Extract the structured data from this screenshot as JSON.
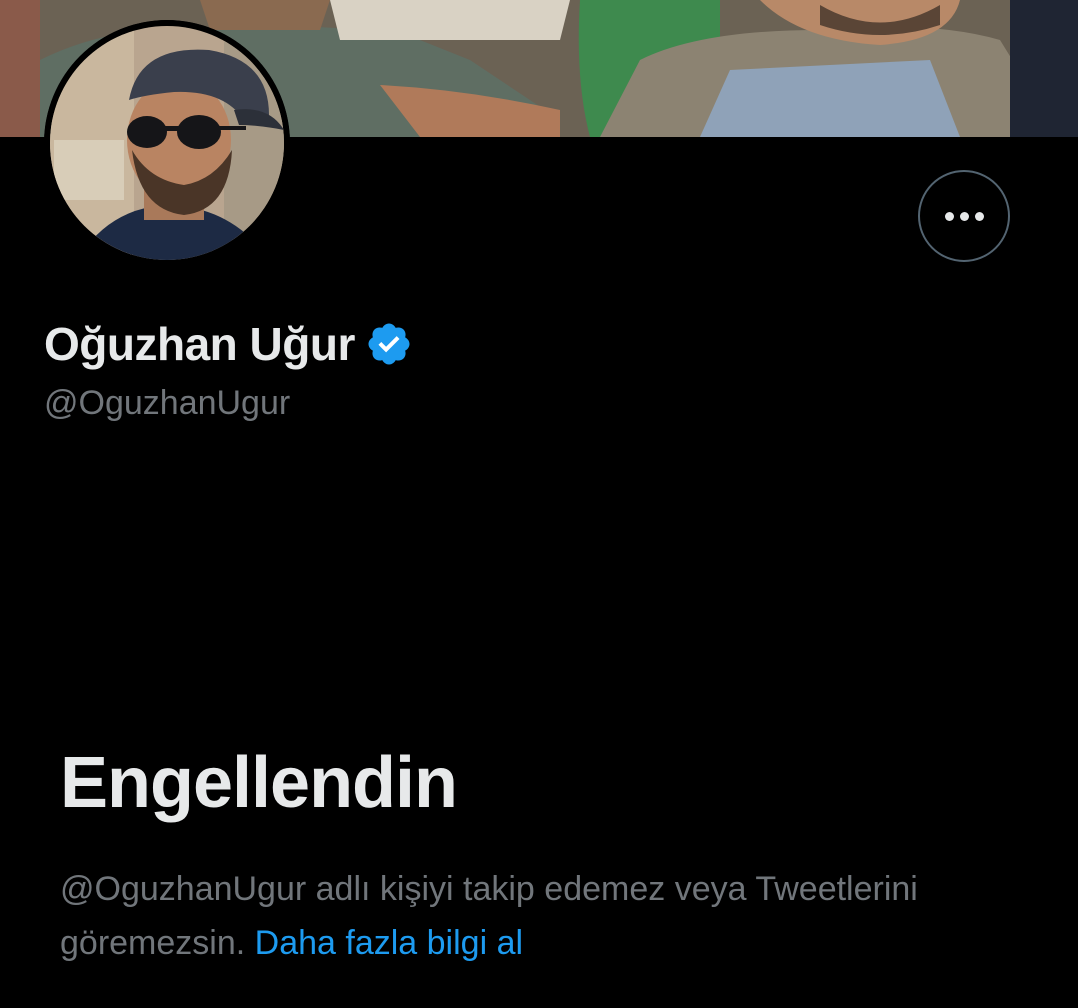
{
  "profile": {
    "display_name": "Oğuzhan Uğur",
    "handle": "@OguzhanUgur",
    "verified_icon": "verified-badge-icon",
    "verified_color": "#1d9bf0"
  },
  "actions": {
    "more_icon": "more-horizontal-icon"
  },
  "blocked": {
    "title": "Engellendin",
    "description": "@OguzhanUgur adlı kişiyi takip edemez veya Tweetlerini göremezsin.",
    "learn_more": "Daha fazla bilgi al"
  },
  "colors": {
    "background": "#000000",
    "primary_text": "#e7e9ea",
    "secondary_text": "#71767b",
    "link": "#1d9bf0",
    "border": "#536471"
  }
}
